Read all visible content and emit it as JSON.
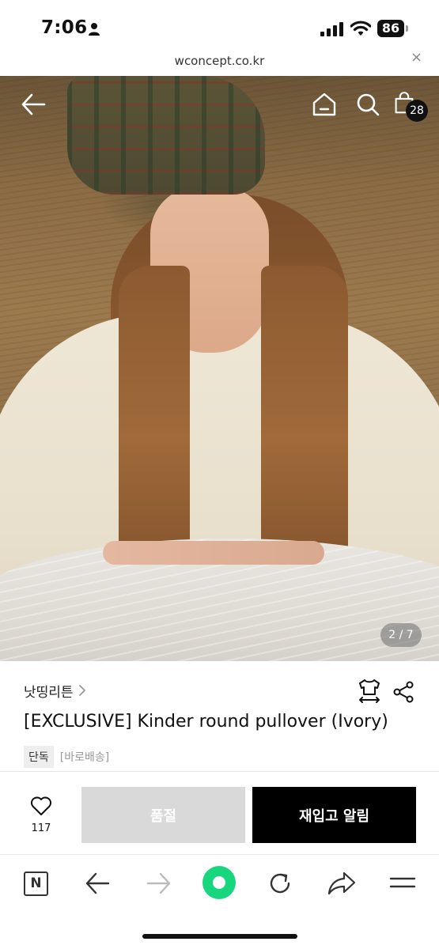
{
  "status_bar": {
    "time": "7:06",
    "battery": "86"
  },
  "url_bar": {
    "url": "wconcept.co.kr",
    "close": "×"
  },
  "hero": {
    "cart_count": "28",
    "pager": "2 / 7"
  },
  "product": {
    "brand": "낫띵리튼",
    "title": "[EXCLUSIVE] Kinder round pullover (Ivory)",
    "tag_exclusive": "단독",
    "tag_delivery": "[바로배송]"
  },
  "actions": {
    "like_count": "117",
    "soldout_label": "품절",
    "restock_label": "재입고 알림"
  },
  "toolbar": {
    "n_label": "N"
  },
  "colors": {
    "accent_green": "#17d67e",
    "soldout_gray": "#d9d9d9",
    "black": "#000000"
  }
}
